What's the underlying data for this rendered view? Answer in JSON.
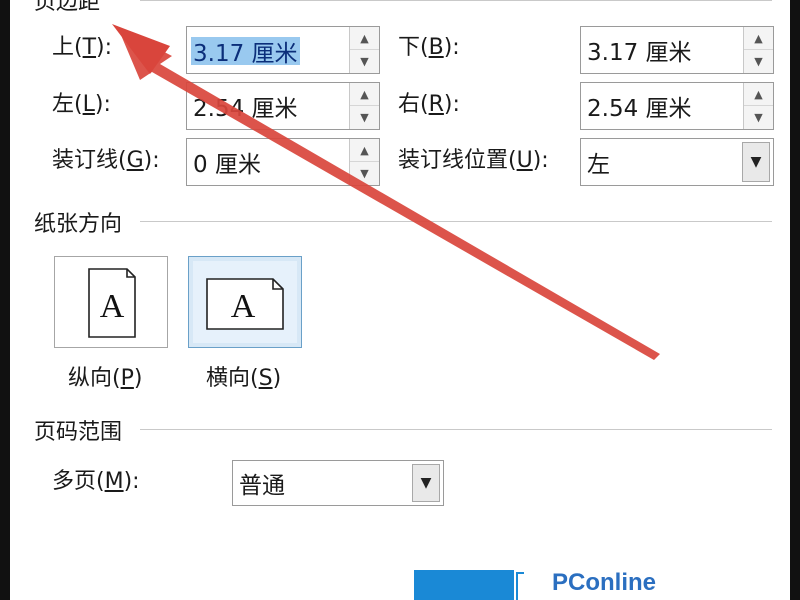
{
  "margins": {
    "group_label": "页边距",
    "top": {
      "label": "上(",
      "key": "T",
      "tail": "):",
      "value": "3.17 厘米"
    },
    "bottom": {
      "label": "下(",
      "key": "B",
      "tail": "):",
      "value": "3.17 厘米"
    },
    "left": {
      "label": "左(",
      "key": "L",
      "tail": "):",
      "value": "2.54 厘米"
    },
    "right": {
      "label": "右(",
      "key": "R",
      "tail": "):",
      "value": "2.54 厘米"
    },
    "gutter": {
      "label": "装订线(",
      "key": "G",
      "tail": "):",
      "value": "0 厘米"
    },
    "gutter_pos": {
      "label": "装订线位置(",
      "key": "U",
      "tail": "):",
      "value": "左"
    }
  },
  "orientation": {
    "group_label": "纸张方向",
    "portrait": {
      "label": "纵向(",
      "key": "P",
      "tail": ")",
      "glyph": "A"
    },
    "landscape": {
      "label": "横向(",
      "key": "S",
      "tail": ")",
      "glyph": "A",
      "selected": true
    }
  },
  "pages": {
    "group_label": "页码范围",
    "multiple": {
      "label": "多页(",
      "key": "M",
      "tail": "):",
      "value": "普通"
    }
  },
  "icons": {
    "spin_up": "▲",
    "spin_down": "▼",
    "dropdown": "▼"
  },
  "annotation": {
    "type": "red-arrow",
    "color": "#d9453c"
  },
  "watermark": {
    "text": "PConline",
    "color": "#2b6fc0"
  }
}
